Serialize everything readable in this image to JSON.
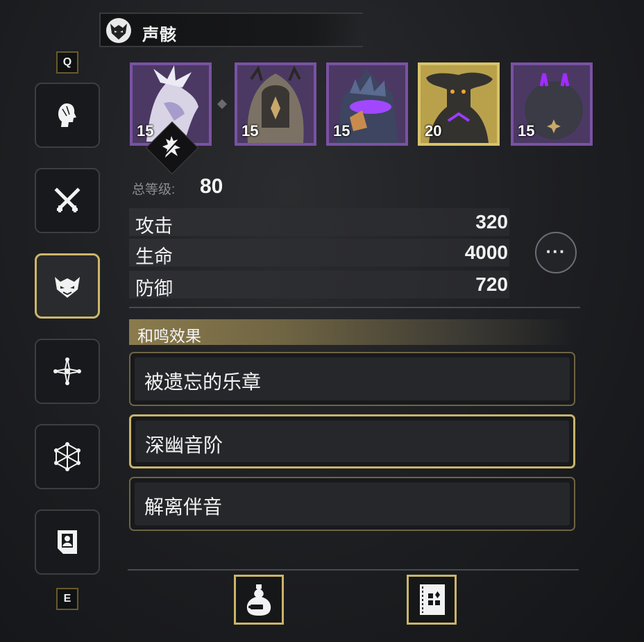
{
  "header": {
    "title": "声骸",
    "icon": "echo-mask-icon"
  },
  "keys": {
    "prev": "Q",
    "next": "E"
  },
  "sidebar": {
    "items": [
      {
        "name": "resonator-portrait",
        "icon": "head-profile-icon",
        "active": false
      },
      {
        "name": "weapon",
        "icon": "crossed-swords-icon",
        "active": false
      },
      {
        "name": "echo",
        "icon": "echo-mask-icon",
        "active": true
      },
      {
        "name": "skills",
        "icon": "star-node-icon",
        "active": false
      },
      {
        "name": "resonance-chain",
        "icon": "hexagon-network-icon",
        "active": false
      },
      {
        "name": "profile",
        "icon": "profile-card-icon",
        "active": false
      }
    ]
  },
  "echoes": [
    {
      "level": "15",
      "colors": [
        "#d8d4e6",
        "#8e7fb4"
      ]
    },
    {
      "level": "15",
      "colors": [
        "#7b7265",
        "#3a3633"
      ]
    },
    {
      "level": "15",
      "colors": [
        "#5a6a90",
        "#a148ff"
      ]
    },
    {
      "level": "20",
      "colors": [
        "#34322f",
        "#9a3cff"
      ],
      "selected": true
    },
    {
      "level": "15",
      "colors": [
        "#3a3b45",
        "#a12cff"
      ]
    }
  ],
  "total": {
    "label": "总等级:",
    "value": "80"
  },
  "stats": [
    {
      "name": "攻击",
      "value": "320"
    },
    {
      "name": "生命",
      "value": "4000"
    },
    {
      "name": "防御",
      "value": "720"
    }
  ],
  "more_label": "···",
  "resonance": {
    "title": "和鸣效果",
    "items": [
      {
        "label": "被遗忘的乐章",
        "selected": false
      },
      {
        "label": "深幽音阶",
        "selected": true
      },
      {
        "label": "解离伴音",
        "selected": false
      }
    ]
  },
  "bottom_buttons": [
    {
      "name": "echo-bag-button",
      "icon": "gourd-bag-icon"
    },
    {
      "name": "echo-archive-button",
      "icon": "archive-book-icon"
    }
  ],
  "colors": {
    "gold": "#cdb66a",
    "purple": "#7a52a4",
    "text": "#f2f2f2"
  }
}
